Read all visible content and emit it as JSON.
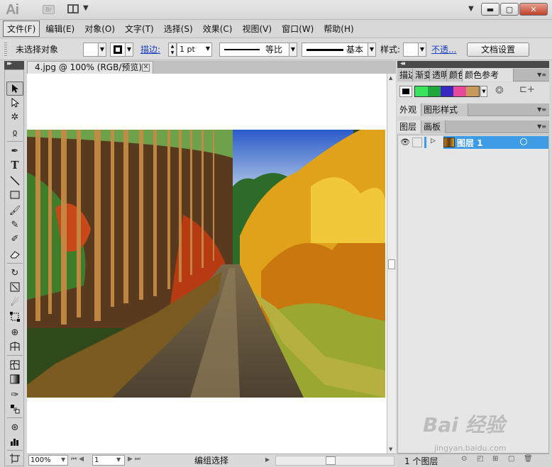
{
  "window": {
    "app_logo": "Ai",
    "bridge_badge": "Br"
  },
  "menu": [
    {
      "label": "文件(F)",
      "active": true
    },
    {
      "label": "编辑(E)"
    },
    {
      "label": "对象(O)"
    },
    {
      "label": "文字(T)"
    },
    {
      "label": "选择(S)"
    },
    {
      "label": "效果(C)"
    },
    {
      "label": "视图(V)"
    },
    {
      "label": "窗口(W)"
    },
    {
      "label": "帮助(H)"
    }
  ],
  "control": {
    "no_selection": "未选择对象",
    "stroke_label": "描边:",
    "stroke_weight": "1 pt",
    "profile": "等比",
    "brush": "基本",
    "style_label": "样式:",
    "opacity_link": "不透...",
    "doc_setup": "文档设置"
  },
  "document": {
    "tab_title": "4.jpg @ 100% (RGB/预览)",
    "zoom": "100%",
    "artboard": "1",
    "status": "编组选择"
  },
  "panels": {
    "group1_tabs": [
      "描边",
      "渐变",
      "透明",
      "颜色",
      "颜色参考"
    ],
    "group2_tabs": [
      "外观",
      "图形样式"
    ],
    "group3_tabs": [
      "图层",
      "画板"
    ],
    "layer_name": "图层 1",
    "layer_count": "1 个图层"
  },
  "colors": {
    "accent": "#3e9be6",
    "swatches": [
      "#39e35d",
      "#20a63e",
      "#3828c0",
      "#e84a9a",
      "#c89a5a"
    ]
  },
  "watermark": {
    "text": "Bai 经验",
    "url": "jingyan.baidu.com"
  }
}
